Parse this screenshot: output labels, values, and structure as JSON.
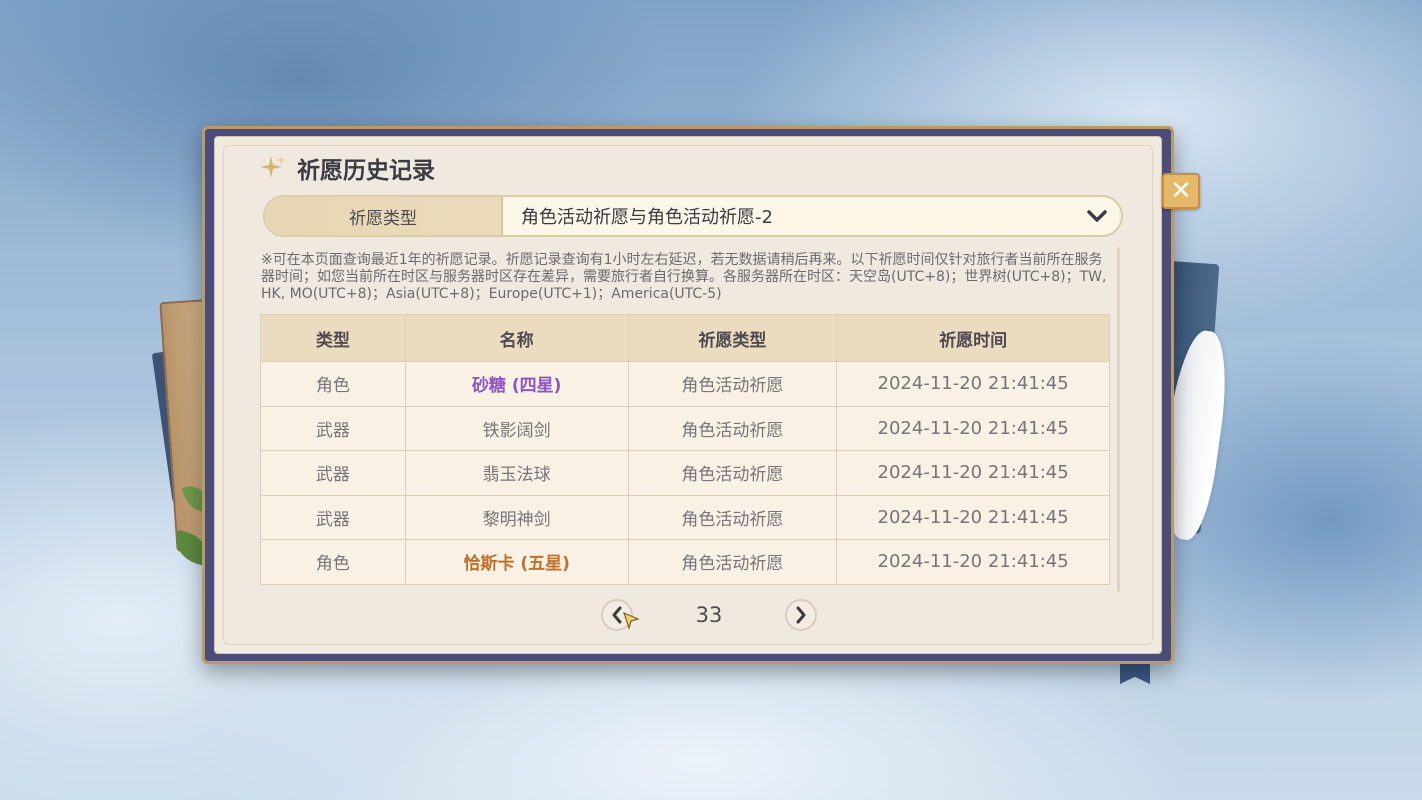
{
  "panel": {
    "title": "祈愿历史记录",
    "close_label": "✕"
  },
  "wish_type": {
    "label": "祈愿类型",
    "selected": "角色活动祈愿与角色活动祈愿-2"
  },
  "notice": "※可在本页面查询最近1年的祈愿记录。祈愿记录查询有1小时左右延迟，若无数据请稍后再来。以下祈愿时间仅针对旅行者当前所在服务器时间；如您当前所在时区与服务器时区存在差异，需要旅行者自行换算。各服务器所在时区：天空岛(UTC+8)；世界树(UTC+8)；TW, HK, MO(UTC+8)；Asia(UTC+8)；Europe(UTC+1)；America(UTC-5)",
  "table": {
    "headers": [
      "类型",
      "名称",
      "祈愿类型",
      "祈愿时间"
    ],
    "rows": [
      {
        "type": "角色",
        "name": "砂糖 (四星)",
        "banner": "角色活动祈愿",
        "time": "2024-11-20 21:41:45",
        "rarity_color": "#8d55c6"
      },
      {
        "type": "武器",
        "name": "铁影阔剑",
        "banner": "角色活动祈愿",
        "time": "2024-11-20 21:41:45",
        "rarity_color": ""
      },
      {
        "type": "武器",
        "name": "翡玉法球",
        "banner": "角色活动祈愿",
        "time": "2024-11-20 21:41:45",
        "rarity_color": ""
      },
      {
        "type": "武器",
        "name": "黎明神剑",
        "banner": "角色活动祈愿",
        "time": "2024-11-20 21:41:45",
        "rarity_color": ""
      },
      {
        "type": "角色",
        "name": "恰斯卡 (五星)",
        "banner": "角色活动祈愿",
        "time": "2024-11-20 21:41:45",
        "rarity_color": "#c0712c"
      }
    ]
  },
  "pagination": {
    "page": "33",
    "prev_icon": "chevron-left-icon",
    "next_icon": "chevron-right-icon"
  }
}
